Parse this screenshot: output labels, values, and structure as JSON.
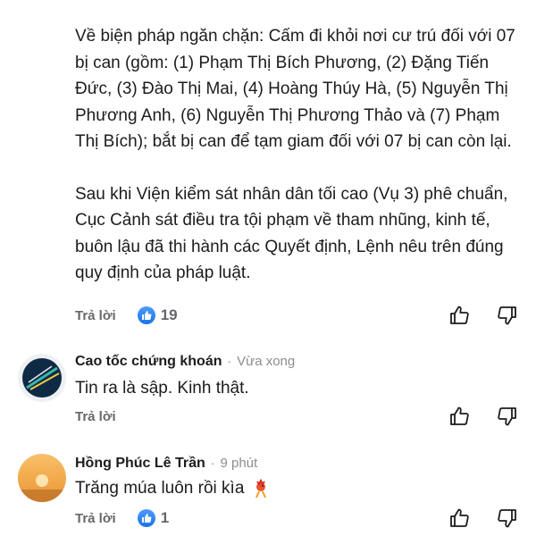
{
  "post": {
    "paragraphs": [
      "Về biện pháp ngăn chặn: Cấm đi khỏi nơi cư trú đối với 07 bị can (gồm: (1) Phạm Thị Bích Phương, (2) Đặng Tiến Đức, (3) Đào Thị Mai, (4) Hoàng Thúy Hà, (5) Nguyễn Thị Phương Anh, (6) Nguyễn Thị Phương Thảo và (7) Phạm Thị Bích); bắt bị can để tạm giam đối với 07 bị can còn lại.",
      "Sau khi Viện kiểm sát nhân dân tối cao (Vụ 3) phê chuẩn, Cục Cảnh sát điều tra tội phạm về tham nhũng, kinh tế, buôn lậu đã thi hành các Quyết định, Lệnh nêu trên đúng quy định của pháp luật."
    ],
    "reply_label": "Trả lời",
    "like_count": "19"
  },
  "comments": [
    {
      "name": "Cao tốc chứng khoán",
      "time": "Vừa xong",
      "text": "Tin ra là sập. Kinh thật.",
      "reply_label": "Trả lời",
      "like_count": ""
    },
    {
      "name": "Hồng Phúc Lê Trần",
      "time": "9 phút",
      "text": "Trăng múa luôn rồi kìa",
      "reply_label": "Trả lời",
      "like_count": "1"
    }
  ],
  "icons": {
    "like_badge": "thumbs-up-icon",
    "upvote": "thumbs-up-outline-icon",
    "downvote": "thumbs-down-outline-icon",
    "emoji": "dancing-rooster-emoji"
  },
  "colors": {
    "like_blue": "#1a73e8",
    "muted": "#65676b",
    "text": "#1c1c1e"
  }
}
